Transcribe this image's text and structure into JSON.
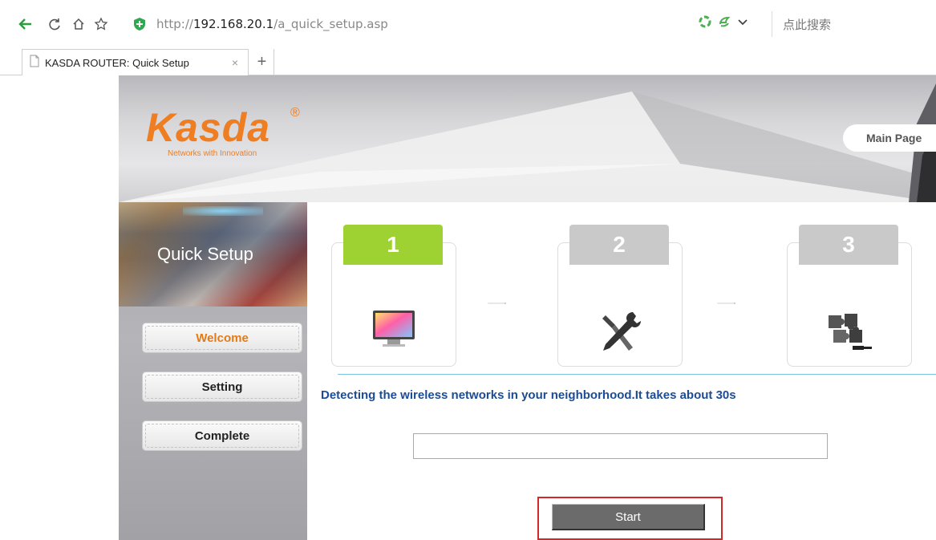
{
  "browser": {
    "url_prefix": "http://",
    "url_host": "192.168.20.1",
    "url_path": "/a_quick_setup.asp",
    "search_placeholder": "点此搜索",
    "tab_title": "KASDA ROUTER: Quick Setup",
    "tab_close": "×",
    "new_tab": "+"
  },
  "banner": {
    "logo_text": "Kasda",
    "logo_mark": "®",
    "logo_tagline": "Networks with Innovation",
    "main_page_link": "Main Page"
  },
  "sidebar": {
    "title": "Quick Setup",
    "items": [
      {
        "label": "Welcome",
        "active": true
      },
      {
        "label": "Setting",
        "active": false
      },
      {
        "label": "Complete",
        "active": false
      }
    ]
  },
  "steps": [
    {
      "number": "1",
      "icon": "monitor-icon",
      "active": true
    },
    {
      "number": "2",
      "icon": "tools-icon",
      "active": false
    },
    {
      "number": "3",
      "icon": "puzzle-icon",
      "active": false
    }
  ],
  "main": {
    "detect_message": "Detecting the wireless networks in your neighborhood.It takes about 30s",
    "start_label": "Start"
  },
  "colors": {
    "accent_orange": "#ef7d21",
    "step_active": "#9ed132",
    "step_inactive": "#c9c9c9",
    "message_blue": "#1b4c94",
    "highlight_red": "#d22828"
  }
}
